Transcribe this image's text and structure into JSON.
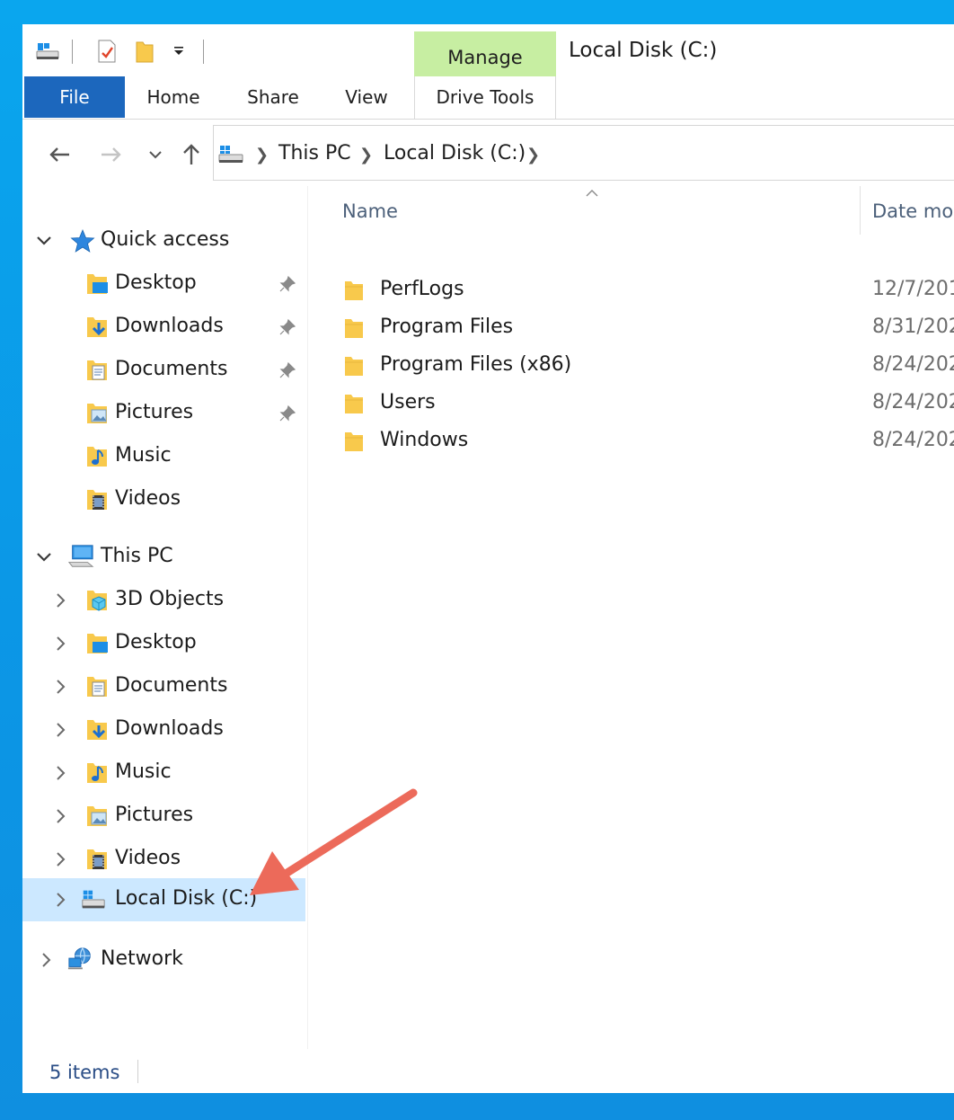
{
  "window": {
    "title": "Local Disk (C:)"
  },
  "ribbon": {
    "tabs": {
      "file": "File",
      "home": "Home",
      "share": "Share",
      "view": "View",
      "manage": "Manage",
      "drive_tools": "Drive Tools"
    }
  },
  "address": {
    "crumbs": [
      "This PC",
      "Local Disk (C:)"
    ]
  },
  "navpane": {
    "quick_access": {
      "label": "Quick access",
      "items": [
        {
          "label": "Desktop",
          "icon": "desktop-folder-icon",
          "pinned": true
        },
        {
          "label": "Downloads",
          "icon": "downloads-folder-icon",
          "pinned": true
        },
        {
          "label": "Documents",
          "icon": "documents-folder-icon",
          "pinned": true
        },
        {
          "label": "Pictures",
          "icon": "pictures-folder-icon",
          "pinned": true
        },
        {
          "label": "Music",
          "icon": "music-folder-icon",
          "pinned": false
        },
        {
          "label": "Videos",
          "icon": "videos-folder-icon",
          "pinned": false
        }
      ]
    },
    "this_pc": {
      "label": "This PC",
      "items": [
        {
          "label": "3D Objects",
          "icon": "3d-objects-folder-icon"
        },
        {
          "label": "Desktop",
          "icon": "desktop-folder-icon"
        },
        {
          "label": "Documents",
          "icon": "documents-folder-icon"
        },
        {
          "label": "Downloads",
          "icon": "downloads-folder-icon"
        },
        {
          "label": "Music",
          "icon": "music-folder-icon"
        },
        {
          "label": "Pictures",
          "icon": "pictures-folder-icon"
        },
        {
          "label": "Videos",
          "icon": "videos-folder-icon"
        },
        {
          "label": "Local Disk (C:)",
          "icon": "local-disk-icon",
          "selected": true
        }
      ]
    },
    "network": {
      "label": "Network"
    }
  },
  "content": {
    "columns": {
      "name": "Name",
      "date": "Date mo"
    },
    "files": [
      {
        "name": "PerfLogs",
        "date": "12/7/201"
      },
      {
        "name": "Program Files",
        "date": "8/31/202"
      },
      {
        "name": "Program Files (x86)",
        "date": "8/24/202"
      },
      {
        "name": "Users",
        "date": "8/24/202"
      },
      {
        "name": "Windows",
        "date": "8/24/202"
      }
    ]
  },
  "status": {
    "item_count": "5 items"
  },
  "colors": {
    "desktop_bg": "#0aa6ee",
    "file_tab": "#1c67bd",
    "manage_tab": "#c7eea2",
    "selection": "#cce8ff",
    "annotation_arrow": "#ec6a5a",
    "folder": "#f8c94c"
  }
}
